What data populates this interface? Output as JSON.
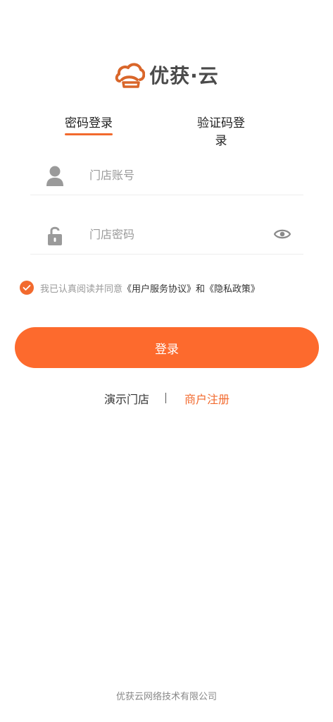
{
  "brand": {
    "logo_text": "优获·云",
    "logo_icon": "cloud-hat-logo",
    "accent_color": "#f26a2e"
  },
  "tabs": [
    {
      "label": "密码登录",
      "active": true
    },
    {
      "label": "验证码登录",
      "active": false
    }
  ],
  "form": {
    "account_placeholder": "门店账号",
    "account_value": "",
    "password_placeholder": "门店密码",
    "password_value": "",
    "account_icon": "user-icon",
    "password_icon": "lock-icon",
    "visibility_icon": "eye-icon"
  },
  "agreement": {
    "checked": true,
    "prefix": "我已认真阅读并同意",
    "user_agreement": "《用户服务协议》",
    "conjunction": "和",
    "privacy_policy": "《隐私政策》"
  },
  "login_button_label": "登录",
  "links": {
    "demo_store": "演示门店",
    "separator": "|",
    "merchant_register": "商户注册"
  },
  "footer_text": "优获云网络技术有限公司"
}
